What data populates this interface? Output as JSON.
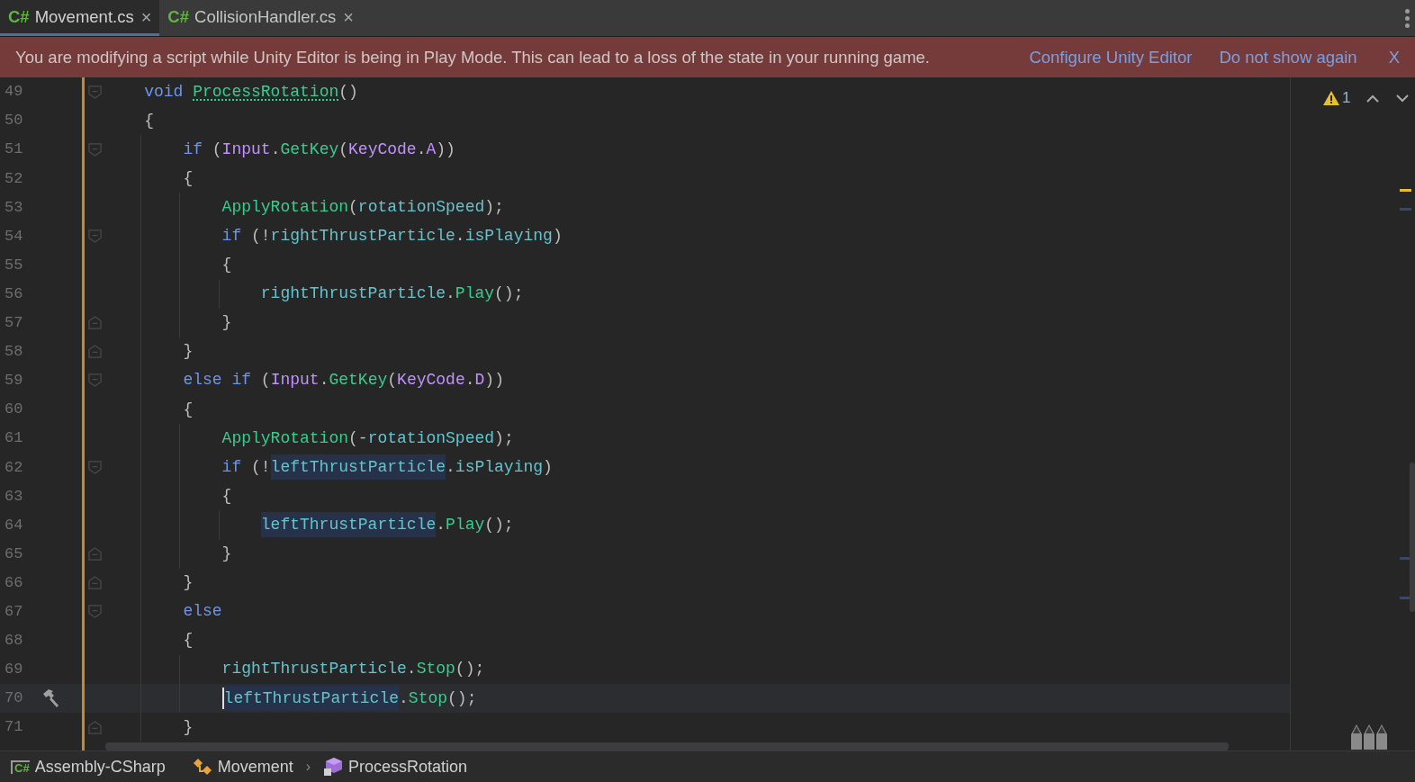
{
  "tabs": [
    {
      "lang": "C#",
      "label": "Movement.cs",
      "close": "×",
      "selected": true
    },
    {
      "lang": "C#",
      "label": "CollisionHandler.cs",
      "close": "×",
      "selected": false
    }
  ],
  "banner": {
    "message": "You are modifying a script while Unity Editor is being in Play Mode. This can lead to a loss of the state in your running game.",
    "links": [
      "Configure Unity Editor",
      "Do not show again"
    ],
    "close": "X"
  },
  "editor": {
    "lines": [
      {
        "number": "49",
        "fold_start": true,
        "tokens": [
          {
            "t": "void ",
            "kind": "keyword"
          },
          {
            "t": "ProcessRotation",
            "kind": "method",
            "dotted": true
          },
          {
            "t": "()",
            "kind": "punct"
          }
        ]
      },
      {
        "number": "50",
        "tokens": [
          {
            "t": "{",
            "kind": "punct"
          }
        ],
        "children": [
          {
            "number": "51",
            "fold_start": true,
            "tokens": [
              {
                "t": "if",
                "kind": "keyword"
              },
              {
                "t": " (",
                "kind": "punct"
              },
              {
                "t": "Input",
                "kind": "type"
              },
              {
                "t": ".",
                "kind": "punct"
              },
              {
                "t": "GetKey",
                "kind": "method"
              },
              {
                "t": "(",
                "kind": "punct"
              },
              {
                "t": "KeyCode",
                "kind": "type"
              },
              {
                "t": ".",
                "kind": "punct"
              },
              {
                "t": "A",
                "kind": "type"
              },
              {
                "t": "))",
                "kind": "punct"
              }
            ]
          },
          {
            "number": "52",
            "tokens": [
              {
                "t": "{",
                "kind": "punct"
              }
            ],
            "children": [
              {
                "number": "53",
                "tokens": [
                  {
                    "t": "ApplyRotation",
                    "kind": "method"
                  },
                  {
                    "t": "(",
                    "kind": "punct"
                  },
                  {
                    "t": "rotationSpeed",
                    "kind": "field"
                  },
                  {
                    "t": ");",
                    "kind": "punct"
                  }
                ]
              },
              {
                "number": "54",
                "fold_start": true,
                "tokens": [
                  {
                    "t": "if",
                    "kind": "keyword"
                  },
                  {
                    "t": " (!",
                    "kind": "punct"
                  },
                  {
                    "t": "rightThrustParticle",
                    "kind": "field"
                  },
                  {
                    "t": ".",
                    "kind": "punct"
                  },
                  {
                    "t": "isPlaying",
                    "kind": "field"
                  },
                  {
                    "t": ")",
                    "kind": "punct"
                  }
                ]
              },
              {
                "number": "55",
                "tokens": [
                  {
                    "t": "{",
                    "kind": "punct"
                  }
                ],
                "children": [
                  {
                    "number": "56",
                    "tokens": [
                      {
                        "t": "rightThrustParticle",
                        "kind": "field"
                      },
                      {
                        "t": ".",
                        "kind": "punct"
                      },
                      {
                        "t": "Play",
                        "kind": "method"
                      },
                      {
                        "t": "();",
                        "kind": "punct"
                      }
                    ]
                  }
                ]
              },
              {
                "number": "57",
                "fold_end": true,
                "tokens": [
                  {
                    "t": "}",
                    "kind": "punct"
                  }
                ]
              }
            ]
          },
          {
            "number": "58",
            "fold_end": true,
            "tokens": [
              {
                "t": "}",
                "kind": "punct"
              }
            ]
          },
          {
            "number": "59",
            "fold_start": true,
            "tokens": [
              {
                "t": "else ",
                "kind": "keyword"
              },
              {
                "t": "if",
                "kind": "keyword"
              },
              {
                "t": " (",
                "kind": "punct"
              },
              {
                "t": "Input",
                "kind": "type"
              },
              {
                "t": ".",
                "kind": "punct"
              },
              {
                "t": "GetKey",
                "kind": "method"
              },
              {
                "t": "(",
                "kind": "punct"
              },
              {
                "t": "KeyCode",
                "kind": "type"
              },
              {
                "t": ".",
                "kind": "punct"
              },
              {
                "t": "D",
                "kind": "type"
              },
              {
                "t": "))",
                "kind": "punct"
              }
            ]
          },
          {
            "number": "60",
            "tokens": [
              {
                "t": "{",
                "kind": "punct"
              }
            ],
            "children": [
              {
                "number": "61",
                "tokens": [
                  {
                    "t": "ApplyRotation",
                    "kind": "method"
                  },
                  {
                    "t": "(-",
                    "kind": "punct"
                  },
                  {
                    "t": "rotationSpeed",
                    "kind": "field"
                  },
                  {
                    "t": ");",
                    "kind": "punct"
                  }
                ]
              },
              {
                "number": "62",
                "fold_start": true,
                "tokens": [
                  {
                    "t": "if",
                    "kind": "keyword"
                  },
                  {
                    "t": " (!",
                    "kind": "punct"
                  },
                  {
                    "t": "leftThrustParticle",
                    "kind": "field",
                    "highlighted": true
                  },
                  {
                    "t": ".",
                    "kind": "punct"
                  },
                  {
                    "t": "isPlaying",
                    "kind": "field"
                  },
                  {
                    "t": ")",
                    "kind": "punct"
                  }
                ]
              },
              {
                "number": "63",
                "tokens": [
                  {
                    "t": "{",
                    "kind": "punct"
                  }
                ],
                "children": [
                  {
                    "number": "64",
                    "tokens": [
                      {
                        "t": "leftThrustParticle",
                        "kind": "field",
                        "highlighted": true
                      },
                      {
                        "t": ".",
                        "kind": "punct"
                      },
                      {
                        "t": "Play",
                        "kind": "method"
                      },
                      {
                        "t": "();",
                        "kind": "punct"
                      }
                    ]
                  }
                ]
              },
              {
                "number": "65",
                "fold_end": true,
                "tokens": [
                  {
                    "t": "}",
                    "kind": "punct"
                  }
                ]
              }
            ]
          },
          {
            "number": "66",
            "fold_end": true,
            "tokens": [
              {
                "t": "}",
                "kind": "punct"
              }
            ]
          },
          {
            "number": "67",
            "fold_start": true,
            "tokens": [
              {
                "t": "else",
                "kind": "keyword"
              }
            ]
          },
          {
            "number": "68",
            "tokens": [
              {
                "t": "{",
                "kind": "punct"
              }
            ],
            "children": [
              {
                "number": "69",
                "tokens": [
                  {
                    "t": "rightThrustParticle",
                    "kind": "field"
                  },
                  {
                    "t": ".",
                    "kind": "punct"
                  },
                  {
                    "t": "Stop",
                    "kind": "method"
                  },
                  {
                    "t": "();",
                    "kind": "punct"
                  }
                ]
              },
              {
                "number": "70",
                "current": true,
                "caret": true,
                "build_hint": true,
                "tokens": [
                  {
                    "t": "leftThrustParticle",
                    "kind": "field",
                    "highlighted": true
                  },
                  {
                    "t": ".",
                    "kind": "punct"
                  },
                  {
                    "t": "Stop",
                    "kind": "method"
                  },
                  {
                    "t": "();",
                    "kind": "punct"
                  }
                ]
              }
            ]
          },
          {
            "number": "71",
            "fold_end": true,
            "tokens": [
              {
                "t": "}",
                "kind": "punct"
              }
            ]
          }
        ]
      }
    ],
    "warnings": "1"
  },
  "breadcrumbs": [
    {
      "kind": "project",
      "badge": "C#",
      "label": "Assembly-CSharp"
    },
    {
      "kind": "class",
      "label": "Movement"
    },
    {
      "kind": "method",
      "separator": "›",
      "label": "ProcessRotation"
    }
  ]
}
